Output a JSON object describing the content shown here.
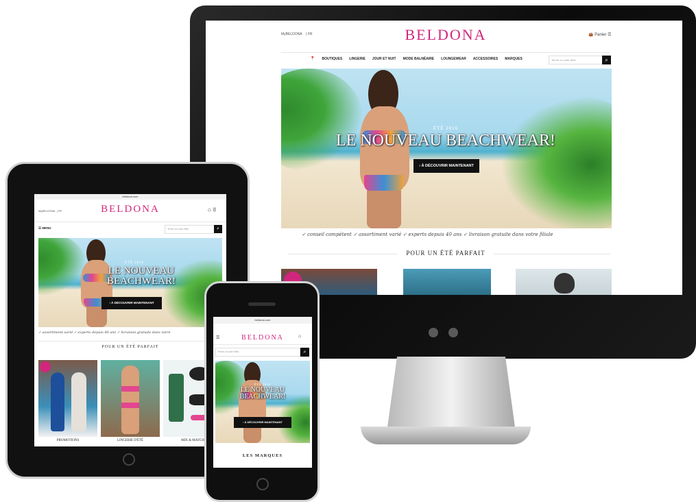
{
  "brand": "BELDONA",
  "desktop": {
    "lang_left": "MyBELDONA",
    "lang_sep": "| FR",
    "cart_label": "Panier",
    "nav_pin": "📍",
    "nav": [
      "BOUTIQUES",
      "LINGERIE",
      "JOUR ET NUIT",
      "MODE BALNÉAIRE",
      "LOUNGEWEAR",
      "ACCESSOIRES",
      "MARQUES"
    ],
    "search_placeholder": "Terme ou code Web",
    "hero_sub": "ÉTÉ 2016",
    "hero_title": "LE NOUVEAU BEACHWEAR!",
    "cta": "› À DÉCOUVRIR MAINTENANT",
    "benefits": "✓ conseil compétent   ✓ assortiment varié   ✓ experts depuis 40 ans   ✓ livraison gratuite dans votre filiale",
    "section_title": "POUR UN ÉTÉ PARFAIT"
  },
  "tablet": {
    "url": "beldona.com",
    "lang_left": "MyBELDONA",
    "lang_sep": "| FR",
    "menu_label": "MENU",
    "search_placeholder": "Terme ou code Web",
    "hero_sub": "ÉTÉ 2016",
    "hero_title_1": "LE NOUVEAU",
    "hero_title_2": "BEACHWEAR!",
    "cta": "› À DÉCOUVRIR MAINTENANT",
    "benefits": "✓ assortiment varié   ✓ experts depuis 40 ans   ✓ livraison gratuite dans votre",
    "section_title": "POUR UN ÉTÉ PARFAIT",
    "tile_labels": [
      "PROMOTIONS",
      "LINGERIE D'ÉTÉ",
      "MIX & MATCH"
    ]
  },
  "phone": {
    "url": "beldona.com",
    "search_placeholder": "Terme ou code Web",
    "hero_sub": "ÉTÉ 2016",
    "hero_title_1": "LE NOUVEAU",
    "hero_title_2": "BEACHWEAR!",
    "cta": "› À DÉCOUVRIR MAINTENANT",
    "section_title": "LES MARQUES"
  },
  "colors": {
    "brand": "#d1267d",
    "cta_bg": "#111111"
  }
}
